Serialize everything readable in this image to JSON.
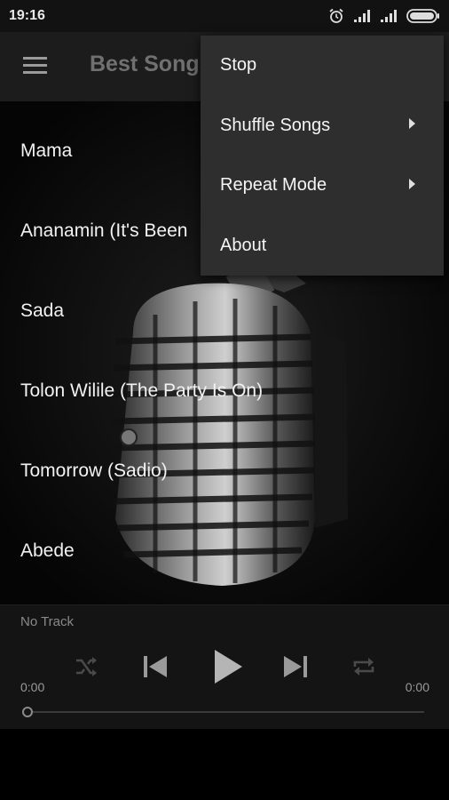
{
  "status_bar": {
    "time": "19:16",
    "icons": [
      "alarm-icon",
      "signal-icon",
      "signal-icon",
      "battery-icon"
    ]
  },
  "app_bar": {
    "title": "Best Songs",
    "menu_icon": "hamburger-menu-icon"
  },
  "songs": [
    {
      "title": "Mama"
    },
    {
      "title": "Ananamin (It's Been"
    },
    {
      "title": "Sada"
    },
    {
      "title": "Tolon Wilile (The Party Is On)"
    },
    {
      "title": "Tomorrow (Sadio)"
    },
    {
      "title": "Abede"
    }
  ],
  "overflow_menu": {
    "items": [
      {
        "label": "Stop",
        "has_submenu": false
      },
      {
        "label": "Shuffle Songs",
        "has_submenu": true
      },
      {
        "label": "Repeat Mode",
        "has_submenu": true
      },
      {
        "label": "About",
        "has_submenu": false
      }
    ]
  },
  "player": {
    "track_label": "No Track",
    "elapsed": "0:00",
    "duration": "0:00",
    "progress": 0,
    "controls": [
      "shuffle-icon",
      "previous-icon",
      "play-icon",
      "next-icon",
      "repeat-icon"
    ]
  },
  "colors": {
    "background": "#000000",
    "app_bar": "#1c1c1c",
    "title": "#707070",
    "menu_bg": "#2e2e2e",
    "player_bg": "#141414"
  }
}
